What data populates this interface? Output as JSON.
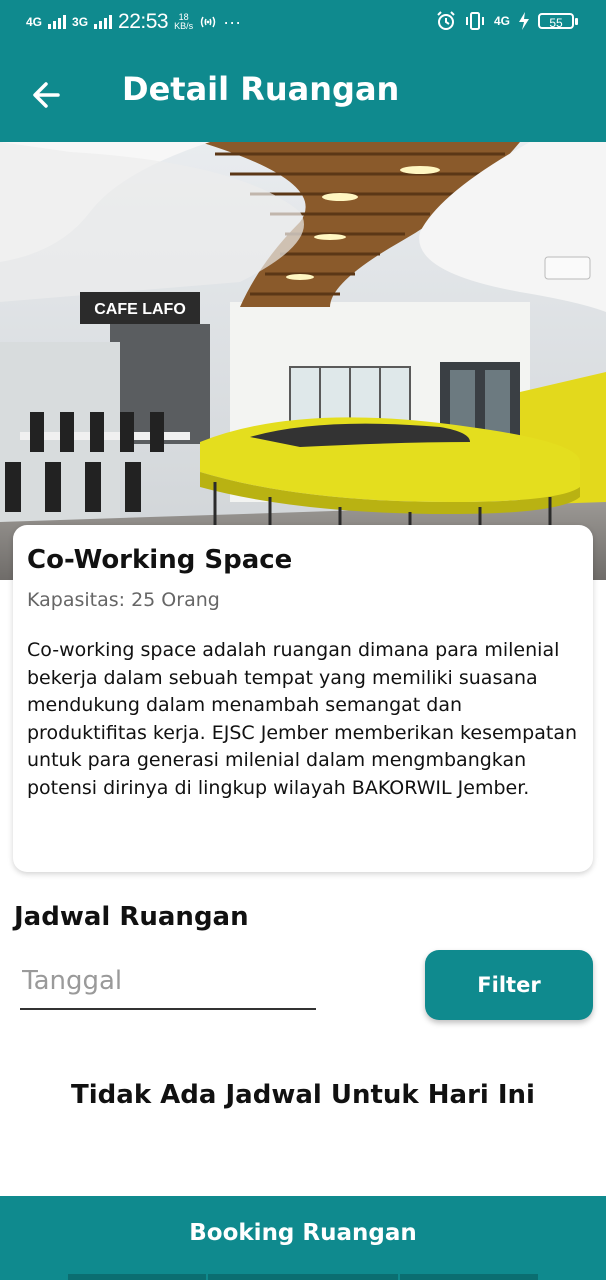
{
  "status_bar": {
    "net1": "4G",
    "net2": "3G",
    "time": "22:53",
    "speed_value": "18",
    "speed_unit": "KB/s",
    "dots": "···",
    "net_right": "4G",
    "battery": "55"
  },
  "appbar": {
    "title": "Detail Ruangan"
  },
  "hero": {
    "sign_text": "CAFE LAFO"
  },
  "room": {
    "name": "Co-Working Space",
    "capacity": "Kapasitas: 25 Orang",
    "description": "Co-working space adalah ruangan dimana para milenial bekerja dalam sebuah tempat yang memiliki suasana mendukung dalam menambah semangat dan produktifitas kerja. EJSC Jember memberikan kesempatan untuk para generasi milenial dalam mengmbangkan potensi dirinya di lingkup wilayah BAKORWIL Jember."
  },
  "schedule": {
    "title": "Jadwal Ruangan",
    "date_placeholder": "Tanggal",
    "filter_label": "Filter",
    "empty_message": "Tidak Ada Jadwal Untuk Hari Ini"
  },
  "booking": {
    "label": "Booking Ruangan"
  },
  "colors": {
    "primary": "#0f8a8e"
  }
}
